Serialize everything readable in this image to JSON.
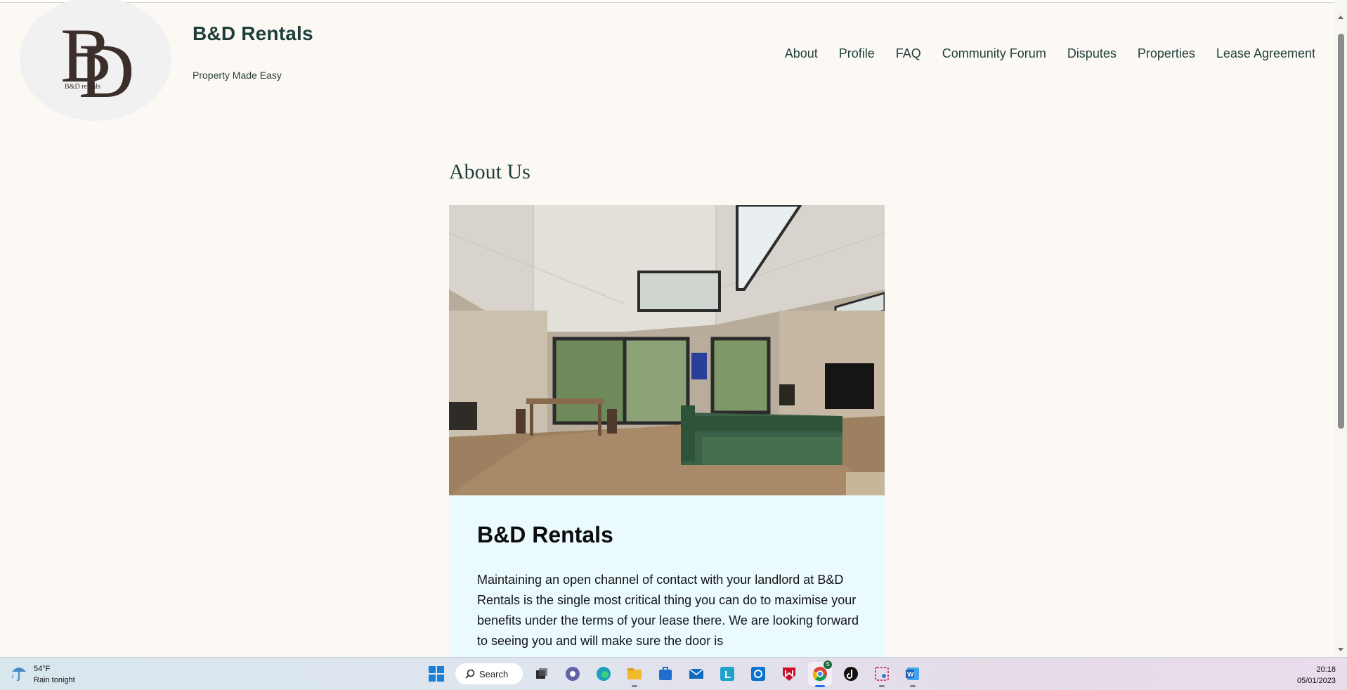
{
  "site": {
    "title": "B&D Rentals",
    "tagline": "Property Made Easy",
    "logo_text": "B&D rentals"
  },
  "nav": {
    "items": [
      "About",
      "Profile",
      "FAQ",
      "Community Forum",
      "Disputes",
      "Properties",
      "Lease Agreement"
    ]
  },
  "main": {
    "heading": "About Us",
    "card_title": "B&D Rentals",
    "card_text": "Maintaining an open channel of contact with your landlord at B&D Rentals is the single most critical thing you can do to maximise your benefits under the terms of your lease there. We are looking forward to seeing you and will make sure the door is"
  },
  "taskbar": {
    "weather_temp": "54°F",
    "weather_desc": "Rain tonight",
    "search_label": "Search",
    "time": "20:18",
    "date": "05/01/2023",
    "chrome_badge": "S"
  },
  "colors": {
    "page_bg": "#fcf9f4",
    "accent": "#1d3e3a",
    "card_bg": "#eafaff"
  }
}
